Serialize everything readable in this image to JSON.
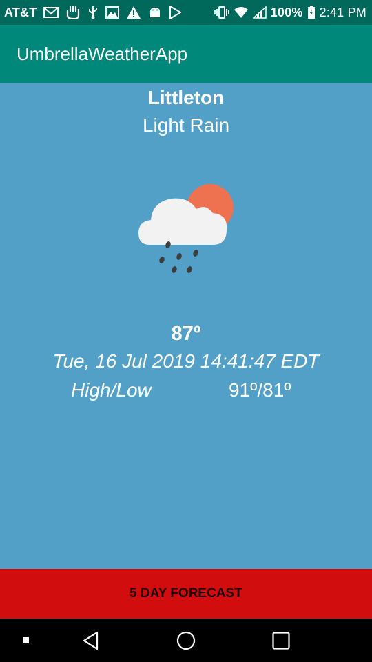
{
  "status_bar": {
    "carrier": "AT&T",
    "battery": "100%",
    "time": "2:41 PM",
    "left_icons": [
      "gmail-icon",
      "hand-icon",
      "usb-icon",
      "image-icon",
      "warning-icon",
      "android-icon",
      "play-store-icon"
    ],
    "right_icons": [
      "vibrate-icon",
      "wifi-icon",
      "signal-icon",
      "battery-icon"
    ]
  },
  "app_bar": {
    "title": "UmbrellaWeatherApp"
  },
  "weather": {
    "city": "Littleton",
    "condition": "Light Rain",
    "icon": "light-rain-icon",
    "temperature": "87º",
    "datetime": "Tue, 16 Jul 2019 14:41:47 EDT",
    "high_low_label": "High/Low",
    "high_low_value": "91º/81º"
  },
  "forecast_button": {
    "label": "5 DAY FORECAST"
  },
  "nav_bar": {
    "items": [
      "recent-dot-icon",
      "back-icon",
      "home-icon",
      "overview-icon"
    ]
  },
  "colors": {
    "status_bar": "#00695c",
    "app_bar": "#00897b",
    "background": "#52a0c7",
    "forecast_button": "#d10d0d"
  }
}
